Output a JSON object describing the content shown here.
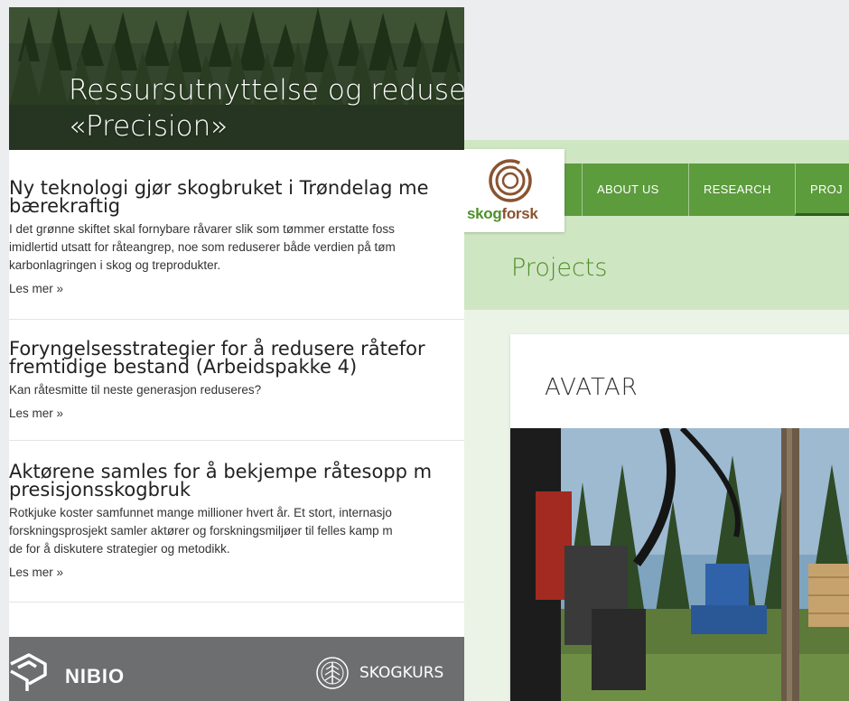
{
  "left_site": {
    "hero": {
      "title": "Ressursutnyttelse og redusert råte i Norske skoger",
      "subtitle": "«Precision»"
    },
    "articles": [
      {
        "title_lines": [
          "Ny teknologi gjør skogbruket i Trøndelag me",
          "bærekraftig"
        ],
        "body_lines": [
          "I det grønne skiftet skal fornybare råvarer slik som tømmer erstatte foss",
          "imidlertid utsatt for råteangrep, noe som reduserer både verdien på tøm",
          "karbonlagringen i skog og treprodukter."
        ],
        "more": "Les mer »"
      },
      {
        "title_lines": [
          "Foryngelsesstrategier for å redusere råtefor",
          "fremtidige bestand (Arbeidspakke 4)"
        ],
        "body_lines": [
          "Kan råtesmitte til neste generasjon reduseres?"
        ],
        "more": "Les mer »"
      },
      {
        "title_lines": [
          "Aktørene samles for å bekjempe råtesopp m",
          "presisjonsskogbruk"
        ],
        "body_lines": [
          "Rotkjuke koster samfunnet mange millioner hvert år. Et stort, internasjo",
          "forskningsprosjekt samler aktører og forskningsmiljøer til felles kamp m",
          "de for å diskutere strategier og metodikk."
        ],
        "more": "Les mer »"
      }
    ],
    "footer": {
      "nibio": "NIBIO",
      "skogkurs": "SKOGKURS"
    }
  },
  "right_site": {
    "logo": {
      "skog": "skog",
      "forsk": "forsk"
    },
    "nav": [
      "ABOUT US",
      "RESEARCH",
      "PROJ"
    ],
    "heading": "Projects",
    "card_title": "AVATAR"
  },
  "colors": {
    "skogforsk_green": "#5c9c3d",
    "skogforsk_brown": "#8a5330",
    "footer_gray": "#6d6e70"
  }
}
